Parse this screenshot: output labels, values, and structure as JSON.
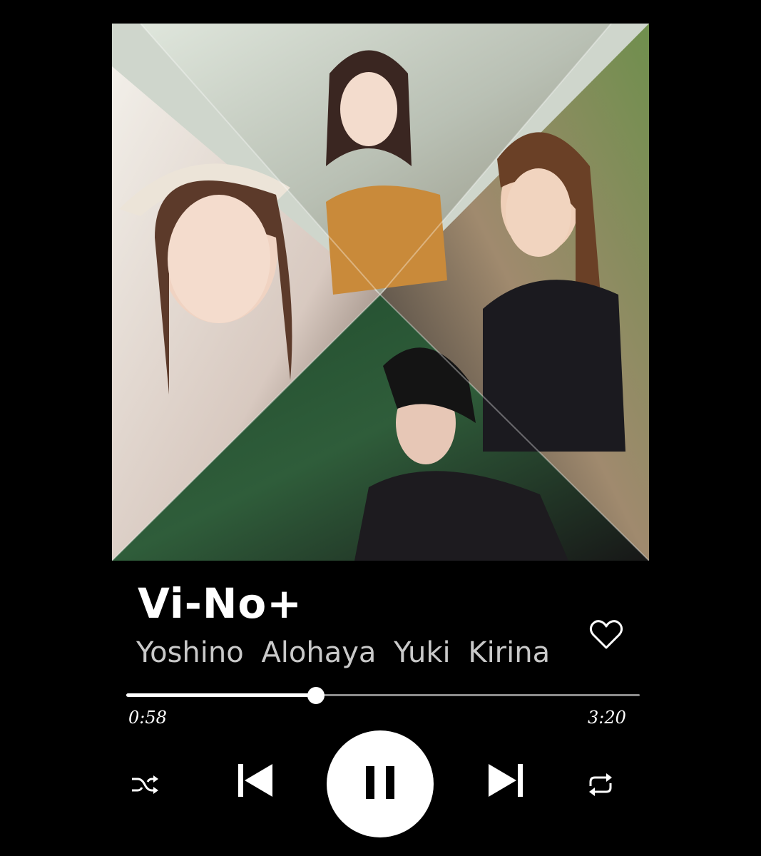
{
  "player": {
    "track_title": "Vi-No+",
    "artists": "Yoshino  Alohaya  Yuki  Kirina",
    "elapsed": "0:58",
    "duration": "3:20",
    "progress_fraction": 0.37,
    "liked": false
  },
  "controls": {
    "shuffle": "shuffle-icon",
    "previous": "skip-previous-icon",
    "play_pause": "pause-icon",
    "next": "skip-next-icon",
    "repeat": "repeat-icon",
    "like": "heart-icon"
  },
  "colors": {
    "background": "#000000",
    "foreground": "#ffffff",
    "track_inactive": "#8c8c8c"
  }
}
